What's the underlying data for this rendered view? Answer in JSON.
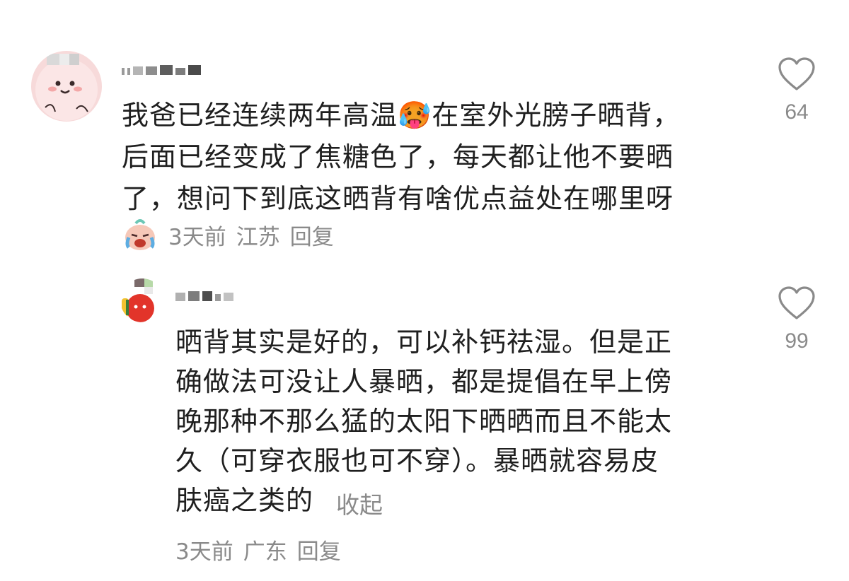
{
  "comments": [
    {
      "text": "我爸已经连续两年高温🥵在室外光膀子晒背，\n后面已经变成了焦糖色了，每天都让他不要晒\n了，想问下到底这晒背有啥优点益处在哪里呀",
      "time": "3天前",
      "location": "江苏",
      "reply_label": "回复",
      "likes": "64",
      "sticker_icon": "crying-face-sticker"
    },
    {
      "text": "晒背其实是好的，可以补钙祛湿。但是正\n确做法可没让人暴晒，都是提倡在早上傍\n晚那种不那么猛的太阳下晒晒而且不能太\n久（可穿衣服也可不穿）。暴晒就容易皮\n肤癌之类的",
      "collapse_label": "收起",
      "time": "3天前",
      "location": "广东",
      "reply_label": "回复",
      "likes": "99"
    }
  ],
  "colors": {
    "text": "#1f1f1f",
    "secondary": "#8a8a8a",
    "background": "#ffffff"
  }
}
